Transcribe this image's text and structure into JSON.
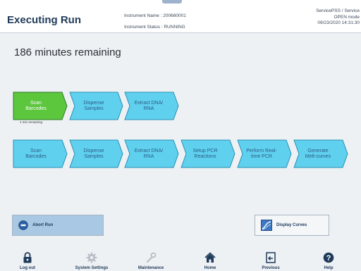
{
  "header": {
    "title": "Executing Run",
    "instrument_name_label": "Instrument Name : 200680001",
    "instrument_status_label": "Instrument Status : RUNNING",
    "user_label": "ServicePSS / Service",
    "mode_label": "OPEN mode",
    "datetime": "09/23/2020 14:31:30"
  },
  "remaining": "186 minutes remaining",
  "row1": {
    "steps": [
      {
        "label": "Scan\nBarcodes",
        "active": true
      },
      {
        "label": "Dispense\nSamples",
        "active": false
      },
      {
        "label": "Extract DNA/\nRNA",
        "active": false
      }
    ],
    "sub_status": "1 min remaining"
  },
  "row2": {
    "steps": [
      {
        "label": "Scan\nBarcodes"
      },
      {
        "label": "Dispense\nSamples"
      },
      {
        "label": "Extract DNA/\nRNA"
      },
      {
        "label": "Setup PCR\nReactions"
      },
      {
        "label": "Perform Real-\ntime PCR"
      },
      {
        "label": "Generate\nMelt-curves"
      }
    ]
  },
  "buttons": {
    "abort": "Abort Run",
    "display_curves": "Display Curves"
  },
  "nav": {
    "logout": "Log out",
    "system_settings": "System Settings",
    "maintenance": "Maintenance",
    "home": "Home",
    "previous": "Previous",
    "help": "Help"
  },
  "colors": {
    "step_fill": "#5fd0ee",
    "step_active": "#5cc63d",
    "step_text": "#2b5d86",
    "abort_bg": "#a9c8e3"
  }
}
